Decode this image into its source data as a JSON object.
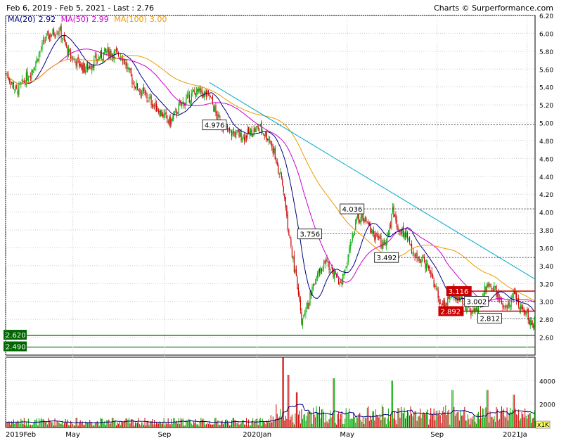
{
  "header": {
    "range_text": "Feb 6, 2019 - Feb 5, 2021 - Last : 2.76",
    "credit": "Charts © Surperformance.com"
  },
  "legend": {
    "ma20_label": "MA(20)",
    "ma20_value": "2.92",
    "ma50_label": "MA(50)",
    "ma50_value": "2.99",
    "ma100_label": "MA(100)",
    "ma100_value": "3.00"
  },
  "colors": {
    "up": "#00aa00",
    "down": "#cc0000",
    "ma20": "#000080",
    "ma50": "#cc00cc",
    "ma100": "#ee9900",
    "trend": "#00aacc",
    "support": "#006600",
    "resistance": "#cc0000",
    "grid": "#cccccc"
  },
  "chart_data": {
    "type": "candlestick",
    "price_axis": {
      "ylim": [
        2.4,
        6.2
      ],
      "ticks": [
        "2.60",
        "2.80",
        "3.00",
        "3.20",
        "3.40",
        "3.60",
        "3.80",
        "4.00",
        "4.20",
        "4.40",
        "4.60",
        "4.80",
        "5.00",
        "5.20",
        "5.40",
        "5.60",
        "5.80",
        "6.00",
        "6.20"
      ]
    },
    "volume_axis": {
      "ylim": [
        0,
        6000
      ],
      "ticks": [
        "2000",
        "4000"
      ],
      "unit_tag": "x1K"
    },
    "x_axis": {
      "ticks": [
        {
          "label": "2019Feb",
          "t": 0.0
        },
        {
          "label": "May",
          "t": 0.127
        },
        {
          "label": "Sep",
          "t": 0.3
        },
        {
          "label": "2020Jan",
          "t": 0.475
        },
        {
          "label": "May",
          "t": 0.645
        },
        {
          "label": "Sep",
          "t": 0.815
        },
        {
          "label": "2021Ja",
          "t": 0.985
        }
      ]
    },
    "price_anchors": [
      [
        0.0,
        5.55
      ],
      [
        0.02,
        5.35
      ],
      [
        0.05,
        5.6
      ],
      [
        0.075,
        5.95
      ],
      [
        0.1,
        6.05
      ],
      [
        0.12,
        5.75
      ],
      [
        0.15,
        5.6
      ],
      [
        0.19,
        5.8
      ],
      [
        0.22,
        5.75
      ],
      [
        0.24,
        5.45
      ],
      [
        0.28,
        5.2
      ],
      [
        0.31,
        5.0
      ],
      [
        0.33,
        5.2
      ],
      [
        0.36,
        5.35
      ],
      [
        0.385,
        5.3
      ],
      [
        0.4,
        5.05
      ],
      [
        0.42,
        4.9
      ],
      [
        0.45,
        4.85
      ],
      [
        0.48,
        4.95
      ],
      [
        0.5,
        4.8
      ],
      [
        0.51,
        4.6
      ],
      [
        0.525,
        4.25
      ],
      [
        0.535,
        3.75
      ],
      [
        0.55,
        3.2
      ],
      [
        0.56,
        2.75
      ],
      [
        0.575,
        3.05
      ],
      [
        0.59,
        3.3
      ],
      [
        0.605,
        3.45
      ],
      [
        0.625,
        3.25
      ],
      [
        0.635,
        3.2
      ],
      [
        0.65,
        3.6
      ],
      [
        0.665,
        3.95
      ],
      [
        0.68,
        3.9
      ],
      [
        0.69,
        3.8
      ],
      [
        0.71,
        3.65
      ],
      [
        0.725,
        3.75
      ],
      [
        0.73,
        4.05
      ],
      [
        0.74,
        3.85
      ],
      [
        0.755,
        3.75
      ],
      [
        0.775,
        3.5
      ],
      [
        0.8,
        3.4
      ],
      [
        0.82,
        3.0
      ],
      [
        0.83,
        2.95
      ],
      [
        0.845,
        3.1
      ],
      [
        0.86,
        3.05
      ],
      [
        0.88,
        2.85
      ],
      [
        0.895,
        2.95
      ],
      [
        0.91,
        3.2
      ],
      [
        0.925,
        3.15
      ],
      [
        0.935,
        3.0
      ],
      [
        0.945,
        2.9
      ],
      [
        0.96,
        3.05
      ],
      [
        0.975,
        2.95
      ],
      [
        0.99,
        2.8
      ],
      [
        1.0,
        2.76
      ]
    ],
    "volume_spikes": [
      [
        0.525,
        6000
      ],
      [
        0.535,
        4500
      ],
      [
        0.55,
        3000
      ],
      [
        0.62,
        4200
      ],
      [
        0.73,
        4000
      ],
      [
        0.845,
        3200
      ],
      [
        0.91,
        3200
      ],
      [
        0.96,
        2800
      ]
    ],
    "moving_averages": [
      {
        "name": "MA(20)",
        "window": 20
      },
      {
        "name": "MA(50)",
        "window": 50
      },
      {
        "name": "MA(100)",
        "window": 100
      }
    ],
    "trend_line": {
      "from": [
        0.385,
        5.45
      ],
      "to": [
        1.0,
        3.25
      ]
    },
    "levels": [
      {
        "label": "4.976",
        "value": 4.976,
        "start": 0.385,
        "kind": "dashed"
      },
      {
        "label": "4.036",
        "value": 4.036,
        "start": 0.645,
        "kind": "dashed"
      },
      {
        "label": "3.756",
        "value": 3.756,
        "start": 0.565,
        "kind": "dashed"
      },
      {
        "label": "3.492",
        "value": 3.492,
        "start": 0.71,
        "kind": "dashed"
      },
      {
        "label": "3.116",
        "value": 3.116,
        "start": 0.835,
        "kind": "red"
      },
      {
        "label": "3.002",
        "value": 3.002,
        "start": 0.88,
        "kind": "dashed"
      },
      {
        "label": "2.892",
        "value": 2.892,
        "start": 0.82,
        "kind": "red"
      },
      {
        "label": "2.812",
        "value": 2.812,
        "start": 0.905,
        "kind": "dashed"
      },
      {
        "label": "2.620",
        "value": 2.62,
        "start": 0.0,
        "kind": "support"
      },
      {
        "label": "2.490",
        "value": 2.49,
        "start": 0.0,
        "kind": "support"
      }
    ]
  }
}
